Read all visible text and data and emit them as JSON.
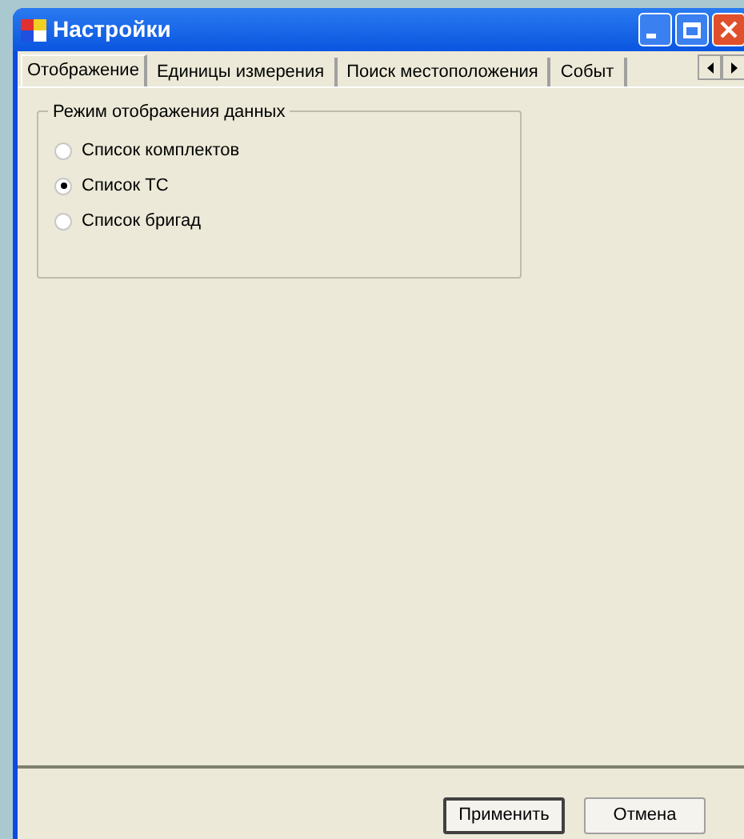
{
  "window": {
    "title": "Настройки"
  },
  "tabs": [
    {
      "label": "Отображение",
      "selected": true
    },
    {
      "label": "Единицы измерения",
      "selected": false
    },
    {
      "label": "Поиск местоположения",
      "selected": false
    },
    {
      "label": "Событ",
      "selected": false
    }
  ],
  "group": {
    "title": "Режим отображения данных",
    "options": [
      {
        "label": "Список комплектов",
        "selected": false
      },
      {
        "label": "Список ТС",
        "selected": true
      },
      {
        "label": "Список бригад",
        "selected": false
      }
    ]
  },
  "buttons": [
    {
      "label": "Применить",
      "default": true
    },
    {
      "label": "Отмена",
      "default": false
    }
  ]
}
